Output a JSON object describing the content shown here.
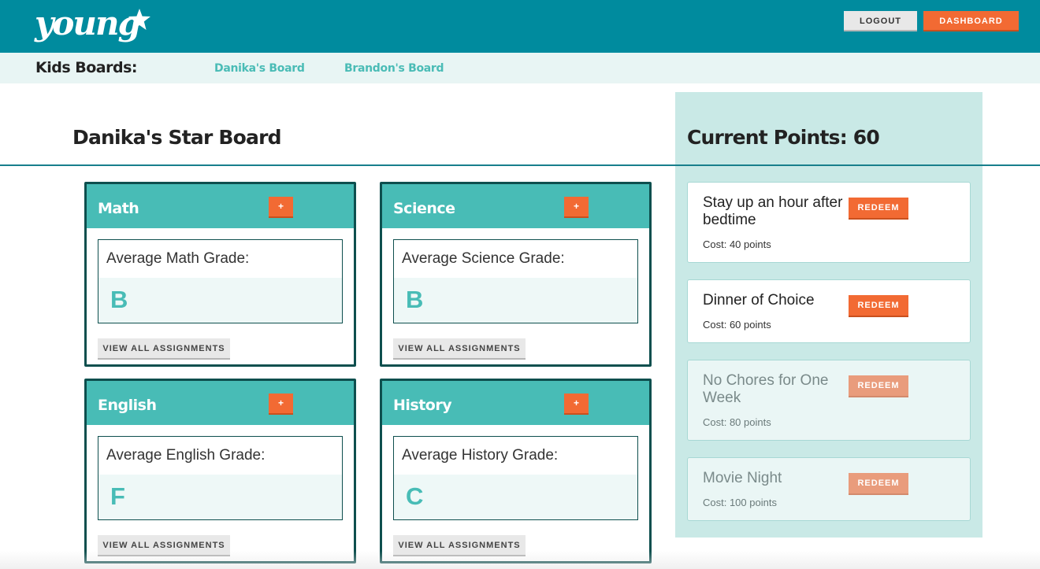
{
  "header": {
    "logo_text": "young",
    "logout_label": "LOGOUT",
    "dashboard_label": "DASHBOARD",
    "bg_color": "#008b9e",
    "accent_color": "#f26a33"
  },
  "kids_nav": {
    "title": "Kids Boards:",
    "links": [
      "Danika's Board",
      "Brandon's Board"
    ]
  },
  "board": {
    "title": "Danika's Star Board",
    "subjects": [
      {
        "name": "Math",
        "add_label": "+",
        "grade_label": "Average Math Grade:",
        "grade": "B",
        "view_label": "VIEW ALL ASSIGNMENTS"
      },
      {
        "name": "Science",
        "add_label": "+",
        "grade_label": "Average Science Grade:",
        "grade": "B",
        "view_label": "VIEW ALL ASSIGNMENTS"
      },
      {
        "name": "English",
        "add_label": "+",
        "grade_label": "Average English Grade:",
        "grade": "F",
        "view_label": "VIEW ALL ASSIGNMENTS"
      },
      {
        "name": "History",
        "add_label": "+",
        "grade_label": "Average History Grade:",
        "grade": "C",
        "view_label": "VIEW ALL ASSIGNMENTS"
      }
    ]
  },
  "rewards_panel": {
    "title": "Current Points: 60",
    "rewards": [
      {
        "name": "Stay up an hour after bedtime",
        "cost": "Cost: 40 points",
        "redeem_label": "REDEEM",
        "available": true
      },
      {
        "name": "Dinner of Choice",
        "cost": "Cost: 60 points",
        "redeem_label": "REDEEM",
        "available": true
      },
      {
        "name": "No Chores for One Week",
        "cost": "Cost: 80 points",
        "redeem_label": "REDEEM",
        "available": false
      },
      {
        "name": "Movie Night",
        "cost": "Cost: 100 points",
        "redeem_label": "REDEEM",
        "available": false
      }
    ]
  }
}
